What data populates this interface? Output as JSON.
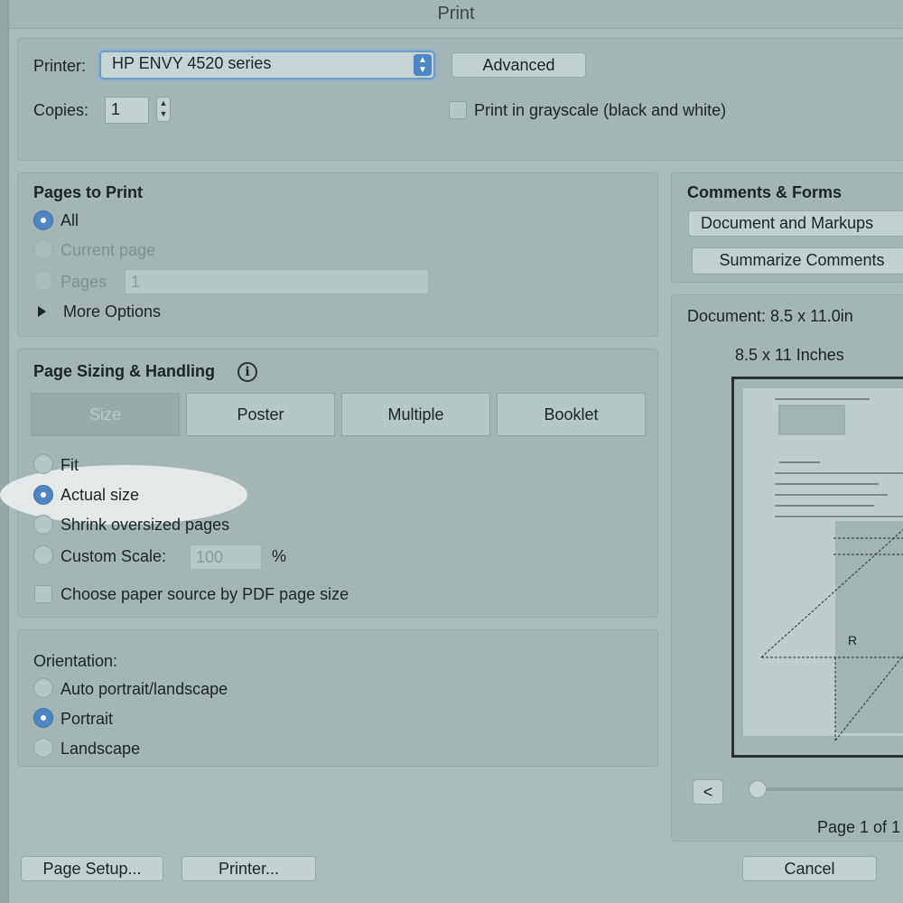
{
  "window": {
    "title": "Print"
  },
  "printer": {
    "label": "Printer:",
    "selected": "HP ENVY 4520 series",
    "advanced_label": "Advanced",
    "copies_label": "Copies:",
    "copies_value": "1",
    "grayscale_label": "Print in grayscale (black and white)",
    "grayscale_checked": false
  },
  "pages_to_print": {
    "heading": "Pages to Print",
    "options": [
      {
        "label": "All",
        "selected": true,
        "enabled": true
      },
      {
        "label": "Current page",
        "selected": false,
        "enabled": false
      },
      {
        "label": "Pages",
        "selected": false,
        "enabled": false
      }
    ],
    "pages_value": "1",
    "more_options_label": "More Options"
  },
  "sizing": {
    "heading": "Page Sizing & Handling",
    "tabs": [
      "Size",
      "Poster",
      "Multiple",
      "Booklet"
    ],
    "active_tab": "Size",
    "options": [
      {
        "label": "Fit",
        "selected": false
      },
      {
        "label": "Actual size",
        "selected": true
      },
      {
        "label": "Shrink oversized pages",
        "selected": false
      },
      {
        "label": "Custom Scale:",
        "selected": false
      }
    ],
    "custom_scale_value": "100",
    "percent_sign": "%",
    "paper_source_label": "Choose paper source by PDF page size",
    "paper_source_checked": false
  },
  "orientation": {
    "heading": "Orientation:",
    "options": [
      {
        "label": "Auto portrait/landscape",
        "selected": false
      },
      {
        "label": "Portrait",
        "selected": true
      },
      {
        "label": "Landscape",
        "selected": false
      }
    ]
  },
  "comments": {
    "heading": "Comments & Forms",
    "selected": "Document and Markups",
    "summarize_label": "Summarize Comments"
  },
  "preview": {
    "document_size": "Document: 8.5 x 11.0in",
    "paper_size": "8.5 x 11 Inches",
    "prev_label": "<",
    "page_status": "Page 1 of 1",
    "page_letter": "R"
  },
  "footer": {
    "page_setup_label": "Page Setup...",
    "printer_label": "Printer...",
    "cancel_label": "Cancel"
  }
}
